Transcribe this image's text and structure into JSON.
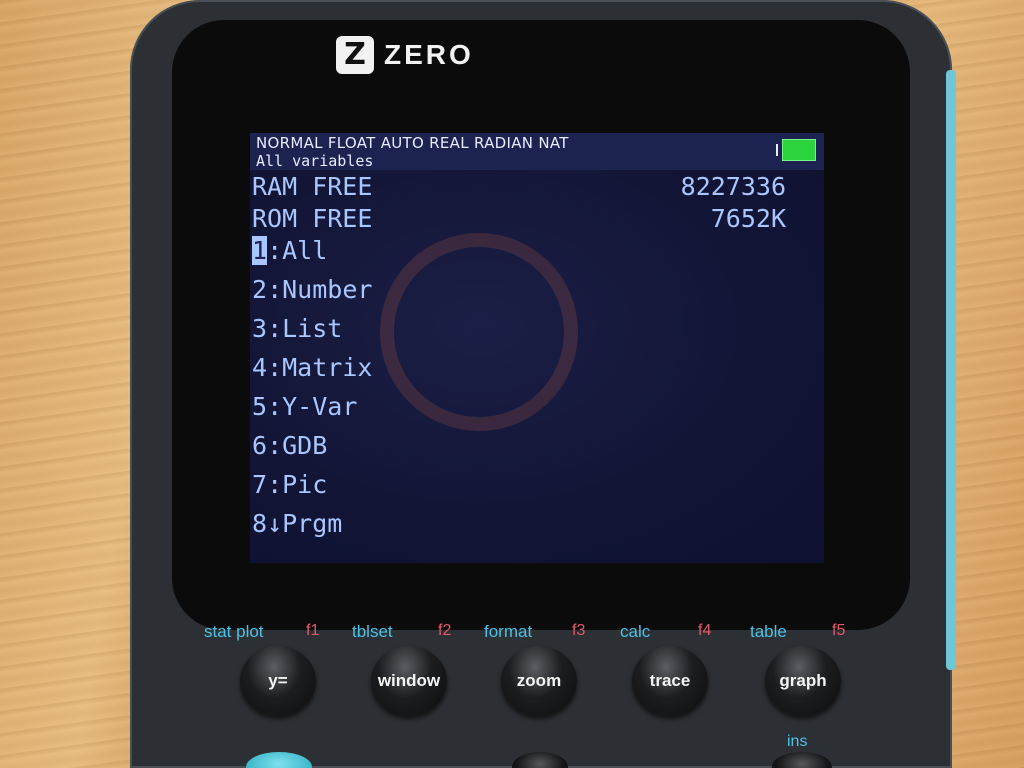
{
  "device": {
    "brand": "ZERO",
    "logo_mark": "Z"
  },
  "screen": {
    "status_bar": {
      "mode": "NORMAL FLOAT AUTO REAL RADIAN NAT",
      "title": "All variables",
      "battery_color": "#2bd43c"
    },
    "memory": [
      {
        "label": "RAM FREE",
        "value": "8227336"
      },
      {
        "label": "ROM FREE",
        "value": "7652K"
      }
    ],
    "menu": [
      {
        "num": "1",
        "sep": ":",
        "label": "All",
        "selected": true
      },
      {
        "num": "2",
        "sep": ":",
        "label": "Number"
      },
      {
        "num": "3",
        "sep": ":",
        "label": "List"
      },
      {
        "num": "4",
        "sep": ":",
        "label": "Matrix"
      },
      {
        "num": "5",
        "sep": ":",
        "label": "Y-Var"
      },
      {
        "num": "6",
        "sep": ":",
        "label": "GDB"
      },
      {
        "num": "7",
        "sep": ":",
        "label": "Pic"
      },
      {
        "num": "8",
        "sep": "↓",
        "label": "Prgm"
      }
    ]
  },
  "keys": {
    "row1": [
      {
        "second": "stat plot",
        "f": "f1",
        "label": "y="
      },
      {
        "second": "tblset",
        "f": "f2",
        "label": "window"
      },
      {
        "second": "format",
        "f": "f3",
        "label": "zoom"
      },
      {
        "second": "calc",
        "f": "f4",
        "label": "trace"
      },
      {
        "second": "table",
        "f": "f5",
        "label": "graph"
      }
    ],
    "ins_label": "ins"
  },
  "colors": {
    "screen_text": "#a9c6ff",
    "second_function": "#4cc3e6",
    "f_key": "#e05a6a"
  }
}
